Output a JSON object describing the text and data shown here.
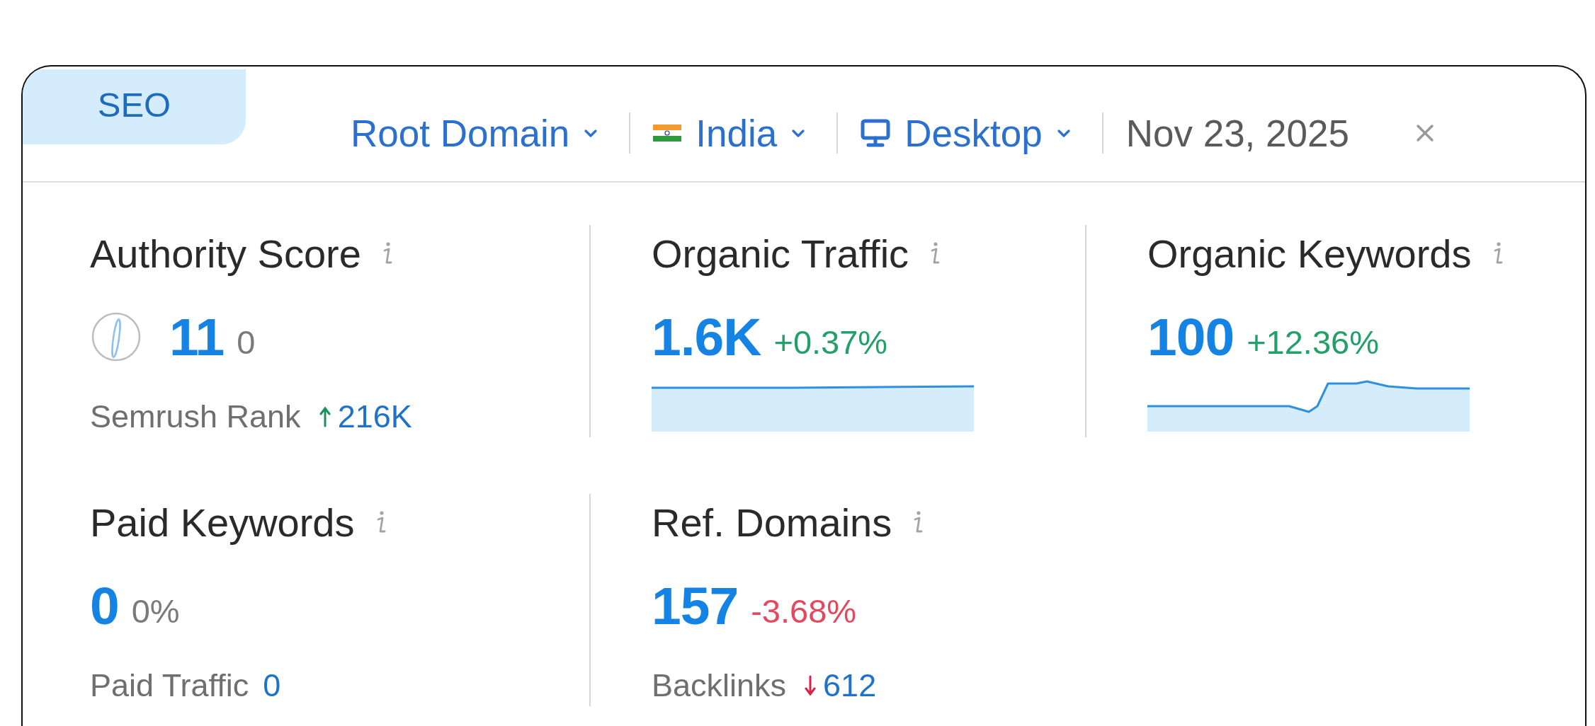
{
  "tab": {
    "label": "SEO",
    "selected": true
  },
  "filters": [
    {
      "kind": "plain",
      "label": "Root Domain"
    },
    {
      "kind": "country",
      "label": "India"
    },
    {
      "kind": "device",
      "label": "Desktop"
    },
    {
      "kind": "date",
      "label": "Nov 23, 2025"
    }
  ],
  "metrics": [
    {
      "title": "Authority Score",
      "kind": "gauge",
      "value": "11",
      "change": {
        "text": "0",
        "color": "#7a7a7a"
      },
      "footer": {
        "label": "Semrush Rank",
        "kind": "rising",
        "value": "216K"
      }
    },
    {
      "title": "Organic Traffic",
      "kind": "flatline",
      "value": "1.6K",
      "change": {
        "text": "+0.37%",
        "color": "#23a06a"
      }
    },
    {
      "title": "Organic Keywords",
      "kind": "stepline",
      "value": "100",
      "change": {
        "text": "+12.36%",
        "color": "#23a06a"
      }
    },
    {
      "title": "Paid Keywords",
      "kind": "plain",
      "value": "0",
      "change": {
        "text": "0%",
        "color": "#7a7a7a"
      },
      "footer": {
        "label": "Paid Traffic",
        "kind": "plain",
        "value": "0"
      }
    },
    {
      "title": "Ref. Domains",
      "kind": "plain",
      "value": "157",
      "change": {
        "text": "-3.68%",
        "color": "#e5485d"
      },
      "footer": {
        "label": "Backlinks",
        "kind": "falling",
        "value": "612"
      }
    }
  ]
}
